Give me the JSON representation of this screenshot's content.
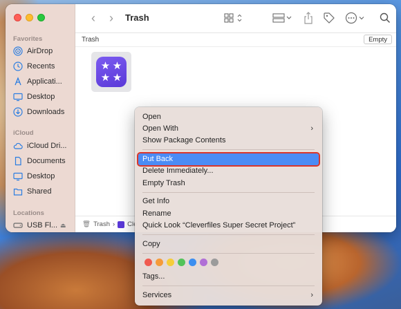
{
  "window": {
    "title": "Trash"
  },
  "sidebar": {
    "favorites_label": "Favorites",
    "icloud_label": "iCloud",
    "locations_label": "Locations",
    "favorites": [
      {
        "label": "AirDrop",
        "icon": "airdrop-icon"
      },
      {
        "label": "Recents",
        "icon": "clock-icon"
      },
      {
        "label": "Applicati...",
        "icon": "applications-icon"
      },
      {
        "label": "Desktop",
        "icon": "desktop-icon"
      },
      {
        "label": "Downloads",
        "icon": "download-icon"
      }
    ],
    "icloud": [
      {
        "label": "iCloud Dri...",
        "icon": "cloud-icon"
      },
      {
        "label": "Documents",
        "icon": "document-icon"
      },
      {
        "label": "Desktop",
        "icon": "desktop-icon"
      },
      {
        "label": "Shared",
        "icon": "shared-folder-icon"
      }
    ],
    "locations": [
      {
        "label": "USB Fl...",
        "icon": "drive-icon"
      }
    ]
  },
  "pathbar": {
    "label": "Trash",
    "empty_label": "Empty"
  },
  "bottombar": {
    "trash_label": "Trash",
    "separator": "›",
    "file_label": "Cle"
  },
  "context_menu": {
    "items": [
      {
        "label": "Open"
      },
      {
        "label": "Open With",
        "submenu": "›"
      },
      {
        "label": "Show Package Contents"
      },
      {
        "label": "Put Back"
      },
      {
        "label": "Delete Immediately..."
      },
      {
        "label": "Empty Trash"
      },
      {
        "label": "Get Info"
      },
      {
        "label": "Rename"
      },
      {
        "label": "Quick Look “Cleverfiles Super Secret Project”"
      },
      {
        "label": "Copy"
      },
      {
        "label": "Tags..."
      },
      {
        "label": "Services",
        "submenu": "›"
      }
    ],
    "tag_colors": [
      "#f05a4f",
      "#f59b3a",
      "#f5cd3a",
      "#52c35a",
      "#3b8ef0",
      "#b06fd6",
      "#9b9b9b"
    ],
    "selected_index": 3
  },
  "colors": {
    "accent": "#4b8cf5",
    "highlight_outline": "#d9362b"
  }
}
